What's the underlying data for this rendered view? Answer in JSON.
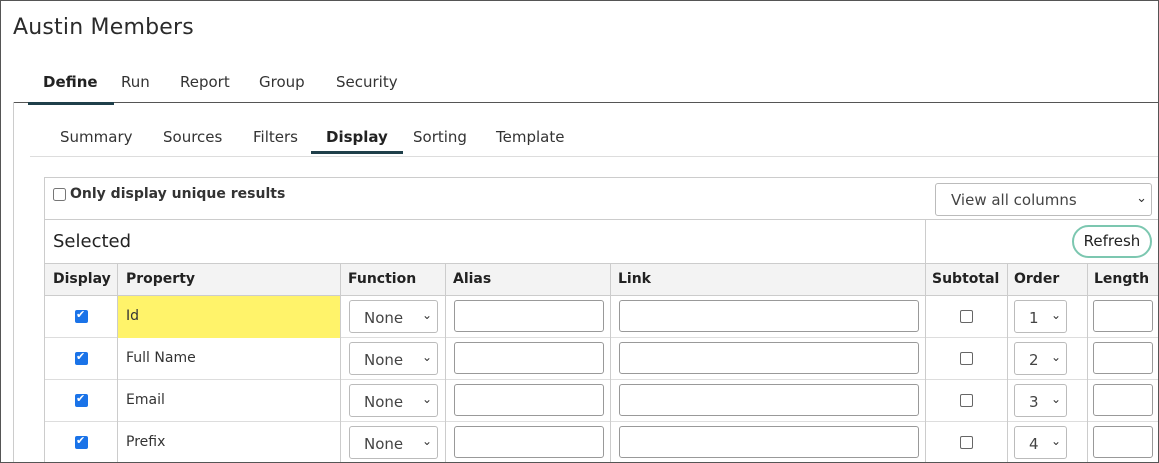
{
  "page_title": "Austin Members",
  "main_tabs": [
    {
      "label": "Define",
      "active": true
    },
    {
      "label": "Run",
      "active": false
    },
    {
      "label": "Report",
      "active": false
    },
    {
      "label": "Group",
      "active": false
    },
    {
      "label": "Security",
      "active": false
    }
  ],
  "sub_tabs": [
    {
      "label": "Summary",
      "active": false
    },
    {
      "label": "Sources",
      "active": false
    },
    {
      "label": "Filters",
      "active": false
    },
    {
      "label": "Display",
      "active": true
    },
    {
      "label": "Sorting",
      "active": false
    },
    {
      "label": "Template",
      "active": false
    }
  ],
  "unique_results": {
    "label": "Only display unique results",
    "checked": false
  },
  "view_select": {
    "value": "View all columns",
    "chevron_icon": "chevron-down-icon"
  },
  "selected_label": "Selected",
  "refresh_label": "Refresh",
  "table": {
    "headers": [
      "Display",
      "Property",
      "Function",
      "Alias",
      "Link",
      "Subtotal",
      "Order",
      "Length"
    ],
    "rows": [
      {
        "display": true,
        "property": "Id",
        "highlight": true,
        "function": "None",
        "alias": "",
        "link": "",
        "subtotal": false,
        "order": "1",
        "length": ""
      },
      {
        "display": true,
        "property": "Full Name",
        "highlight": false,
        "function": "None",
        "alias": "",
        "link": "",
        "subtotal": false,
        "order": "2",
        "length": ""
      },
      {
        "display": true,
        "property": "Email",
        "highlight": false,
        "function": "None",
        "alias": "",
        "link": "",
        "subtotal": false,
        "order": "3",
        "length": ""
      },
      {
        "display": true,
        "property": "Prefix",
        "highlight": false,
        "function": "None",
        "alias": "",
        "link": "",
        "subtotal": false,
        "order": "4",
        "length": ""
      }
    ]
  },
  "colors": {
    "active_tab_underline": "#1f3f4a",
    "highlight": "#fff36a",
    "refresh_border": "#7cc7b0",
    "checkbox": "#1a73e8"
  }
}
